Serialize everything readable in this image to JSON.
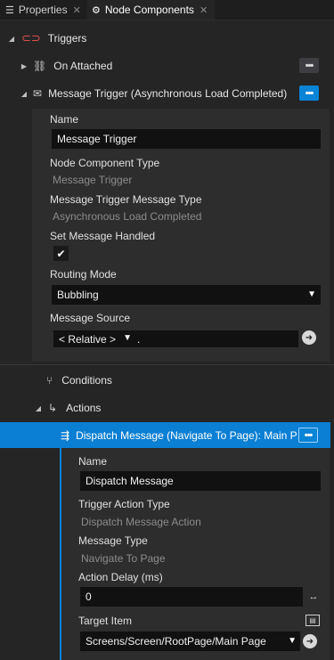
{
  "tabs": [
    {
      "label": "Properties",
      "close": "✕"
    },
    {
      "label": "Node Components",
      "close": "✕"
    }
  ],
  "triggers": {
    "label": "Triggers"
  },
  "on_attached": {
    "label": "On Attached",
    "menu": "•••"
  },
  "message_trigger": {
    "label": "Message Trigger (Asynchronous Load Completed)",
    "menu": "•••",
    "name_label": "Name",
    "name_value": "Message Trigger",
    "component_type_label": "Node Component Type",
    "component_type_value": "Message Trigger",
    "message_type_label": "Message Trigger Message Type",
    "message_type_value": "Asynchronous Load Completed",
    "handled_label": "Set Message Handled",
    "handled_checked": true,
    "routing_label": "Routing Mode",
    "routing_value": "Bubbling",
    "source_label": "Message Source",
    "source_mode": "< Relative >",
    "source_path": "."
  },
  "conditions": {
    "label": "Conditions"
  },
  "actions": {
    "label": "Actions"
  },
  "dispatch": {
    "label": "Dispatch Message (Navigate To Page): Main Page",
    "menu": "•••",
    "name_label": "Name",
    "name_value": "Dispatch Message",
    "action_type_label": "Trigger Action Type",
    "action_type_value": "Dispatch Message Action",
    "message_type_label": "Message Type",
    "message_type_value": "Navigate To Page",
    "delay_label": "Action Delay (ms)",
    "delay_value": "0",
    "target_label": "Target Item",
    "target_value": "Screens/Screen/RootPage/Main Page"
  }
}
